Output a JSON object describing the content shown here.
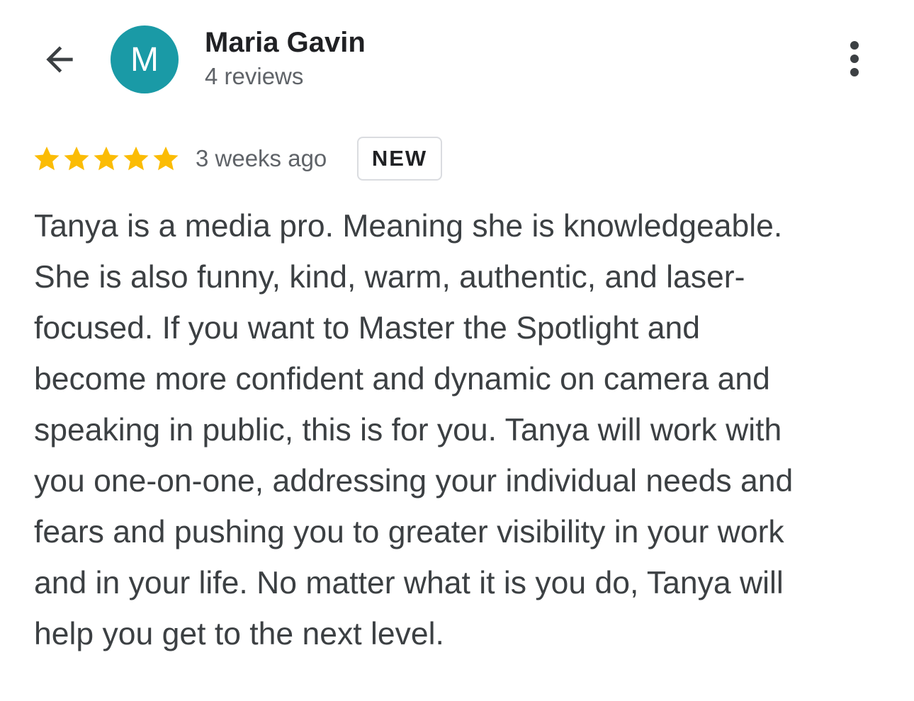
{
  "header": {
    "back_icon": "arrow-back-icon",
    "avatar": {
      "initial": "M",
      "bg_color": "#1a9aa6"
    },
    "user_name": "Maria Gavin",
    "review_count": "4 reviews",
    "more_icon": "more-vertical-icon"
  },
  "review": {
    "rating": 5,
    "rating_max": 5,
    "star_color": "#fbbc04",
    "time_ago": "3 weeks ago",
    "badge": "NEW",
    "lines": [
      "Tanya is a media pro. Meaning she is knowledgeable.",
      "She is also funny, kind, warm, authentic, and laser-",
      "focused. If you want to Master the Spotlight and",
      "become more confident and dynamic on camera and",
      "speaking in public, this is for you. Tanya will work with",
      "you one-on-one, addressing your individual needs and",
      "fears and pushing you to greater visibility in your work",
      "and in your life. No matter what it is you do, Tanya will",
      "help you get to the next level."
    ]
  }
}
